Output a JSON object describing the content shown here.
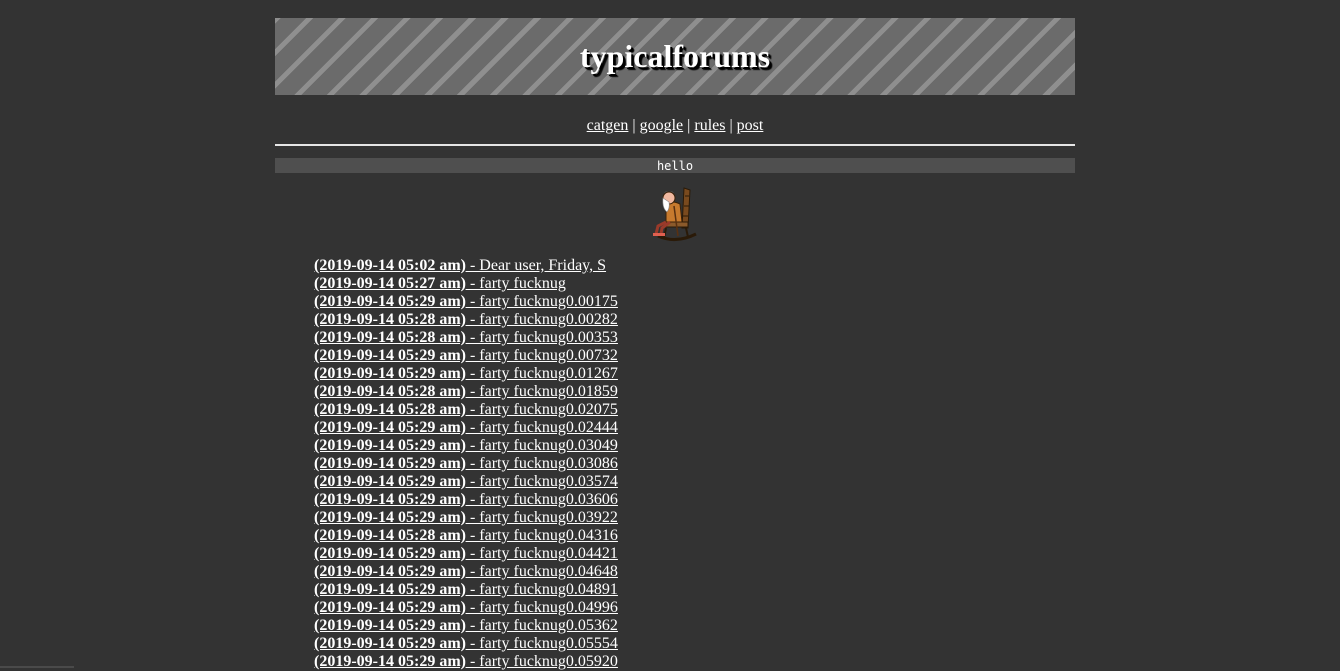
{
  "header": {
    "title": "typicalforums"
  },
  "nav": {
    "links": [
      "catgen",
      "google",
      "rules",
      "post"
    ],
    "separator": "|"
  },
  "motd": {
    "text": "hello"
  },
  "mascot": {
    "icon": "old-man-rocking-chair-icon"
  },
  "posts": [
    {
      "timestamp": "(2019-09-14 05:02 am)",
      "title": " - Dear user, Friday, S"
    },
    {
      "timestamp": "(2019-09-14 05:27 am)",
      "title": " - farty fucknug"
    },
    {
      "timestamp": "(2019-09-14 05:29 am)",
      "title": " - farty fucknug0.00175"
    },
    {
      "timestamp": "(2019-09-14 05:28 am)",
      "title": " - farty fucknug0.00282"
    },
    {
      "timestamp": "(2019-09-14 05:28 am)",
      "title": " - farty fucknug0.00353"
    },
    {
      "timestamp": "(2019-09-14 05:29 am)",
      "title": " - farty fucknug0.00732"
    },
    {
      "timestamp": "(2019-09-14 05:29 am)",
      "title": " - farty fucknug0.01267"
    },
    {
      "timestamp": "(2019-09-14 05:28 am)",
      "title": " - farty fucknug0.01859"
    },
    {
      "timestamp": "(2019-09-14 05:28 am)",
      "title": " - farty fucknug0.02075"
    },
    {
      "timestamp": "(2019-09-14 05:29 am)",
      "title": " - farty fucknug0.02444"
    },
    {
      "timestamp": "(2019-09-14 05:29 am)",
      "title": " - farty fucknug0.03049"
    },
    {
      "timestamp": "(2019-09-14 05:29 am)",
      "title": " - farty fucknug0.03086"
    },
    {
      "timestamp": "(2019-09-14 05:29 am)",
      "title": " - farty fucknug0.03574"
    },
    {
      "timestamp": "(2019-09-14 05:29 am)",
      "title": " - farty fucknug0.03606"
    },
    {
      "timestamp": "(2019-09-14 05:29 am)",
      "title": " - farty fucknug0.03922"
    },
    {
      "timestamp": "(2019-09-14 05:28 am)",
      "title": " - farty fucknug0.04316"
    },
    {
      "timestamp": "(2019-09-14 05:29 am)",
      "title": " - farty fucknug0.04421"
    },
    {
      "timestamp": "(2019-09-14 05:29 am)",
      "title": " - farty fucknug0.04648"
    },
    {
      "timestamp": "(2019-09-14 05:29 am)",
      "title": " - farty fucknug0.04891"
    },
    {
      "timestamp": "(2019-09-14 05:29 am)",
      "title": " - farty fucknug0.04996"
    },
    {
      "timestamp": "(2019-09-14 05:29 am)",
      "title": " - farty fucknug0.05362"
    },
    {
      "timestamp": "(2019-09-14 05:29 am)",
      "title": " - farty fucknug0.05554"
    },
    {
      "timestamp": "(2019-09-14 05:29 am)",
      "title": " - farty fucknug0.05920"
    }
  ]
}
